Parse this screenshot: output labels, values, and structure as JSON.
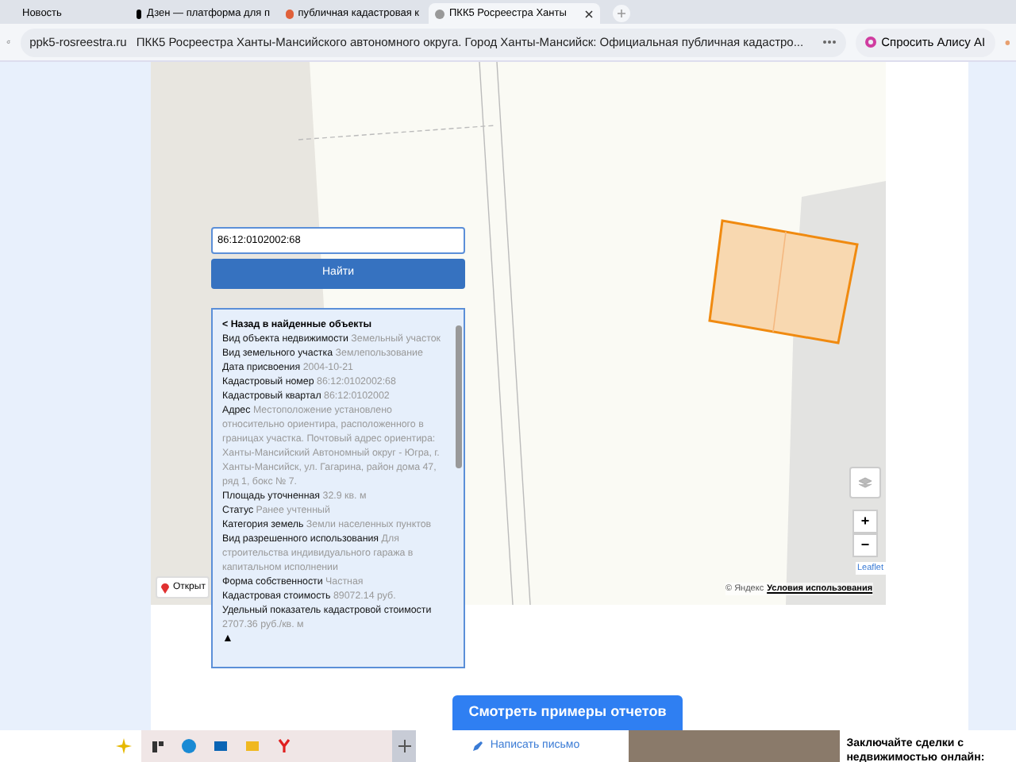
{
  "tabs": [
    {
      "title": "Новость",
      "selected": false
    },
    {
      "title": "Дзен — платформа для п",
      "selected": false
    },
    {
      "title": "публичная кадастровая к",
      "selected": false
    },
    {
      "title": "ПКК5 Росреестра Ханты",
      "selected": true
    }
  ],
  "address_bar": {
    "domain": "ppk5-rosreestra.ru",
    "page_title": "ПКК5 Росреестра Ханты-Мансийского автономного округа. Город Ханты-Мансийск: Официальная публичная кадастро...",
    "ask_button": "Спросить Алису AI"
  },
  "map": {
    "search": {
      "value": "86:12:0102002:68"
    },
    "find_button": "Найти",
    "open_button": "Открыт",
    "leaflet_link": "Leaflet",
    "attribution": "© Яндекс",
    "terms_link": "Условия использования",
    "zoom_in": "+",
    "zoom_out": "−",
    "info": {
      "back_link": "< Назад в найденные объекты",
      "fields": [
        {
          "label": "Вид объекта недвижимости",
          "value": "Земельный участок"
        },
        {
          "label": "Вид земельного участка",
          "value": "Землепользование"
        },
        {
          "label": "Дата присвоения",
          "value": "2004-10-21"
        },
        {
          "label": "Кадастровый номер",
          "value": "86:12:0102002:68"
        },
        {
          "label": "Кадастровый квартал",
          "value": "86:12:0102002"
        },
        {
          "label": "Адрес",
          "value": "Местоположение установлено относительно ориентира, расположенного в границах участка. Почтовый адрес ориентира: Ханты-Мансийский Автономный округ - Югра, г. Ханты-Мансийск, ул. Гагарина, район дома 47, ряд 1, бокс № 7."
        },
        {
          "label": "Площадь уточненная",
          "value": "32.9 кв. м"
        },
        {
          "label": "Статус",
          "value": "Ранее учтенный"
        },
        {
          "label": "Категория земель",
          "value": "Земли населенных пунктов"
        },
        {
          "label": "Вид разрешенного использования",
          "value": "Для строительства индивидуального гаража в капитальном исполнении"
        },
        {
          "label": "Форма собственности",
          "value": "Частная"
        },
        {
          "label": "Кадастровая стоимость",
          "value": "89072.14 руб."
        },
        {
          "label": "Удельный показатель кадастровой стоимости",
          "value": "2707.36 руб./кв. м"
        }
      ],
      "collapse": "▲"
    }
  },
  "examples_button": "Смотреть примеры отчетов",
  "write_link": "Написать письмо",
  "promo_text": "Заключайте сделки с недвижимостью онлайн:"
}
